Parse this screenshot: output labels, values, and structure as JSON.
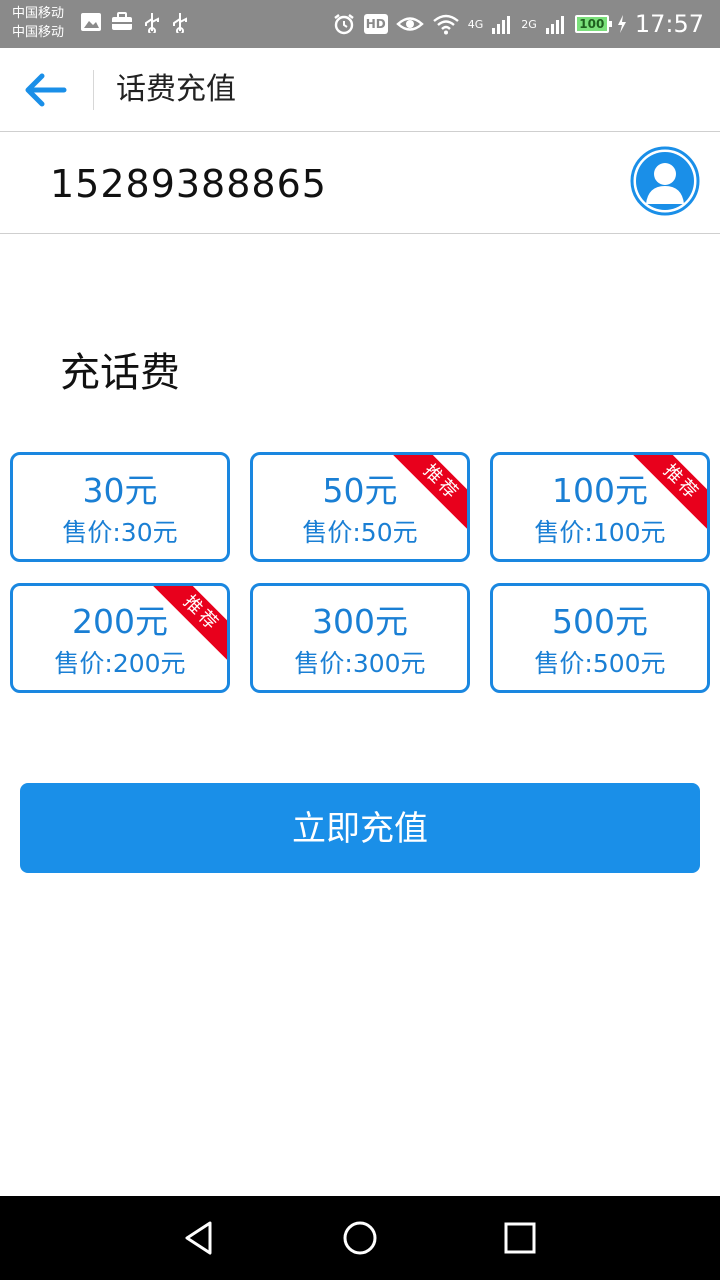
{
  "status_bar": {
    "carrier_1": "中国移动",
    "carrier_2": "中国移动",
    "hd_label": "HD",
    "net_4g": "4G",
    "net_2g": "2G",
    "battery": "100",
    "time": "17:57"
  },
  "header": {
    "title": "话费充值"
  },
  "phone": {
    "number": "15289388865"
  },
  "section": {
    "title": "充话费"
  },
  "packages": [
    {
      "amount": "30元",
      "price": "售价:30元",
      "badge": ""
    },
    {
      "amount": "50元",
      "price": "售价:50元",
      "badge": "推荐"
    },
    {
      "amount": "100元",
      "price": "售价:100元",
      "badge": "推荐"
    },
    {
      "amount": "200元",
      "price": "售价:200元",
      "badge": "推荐"
    },
    {
      "amount": "300元",
      "price": "售价:300元",
      "badge": ""
    },
    {
      "amount": "500元",
      "price": "售价:500元",
      "badge": ""
    }
  ],
  "actions": {
    "recharge_label": "立即充值"
  },
  "colors": {
    "accent": "#1a8fe8",
    "badge": "#e8001c"
  }
}
